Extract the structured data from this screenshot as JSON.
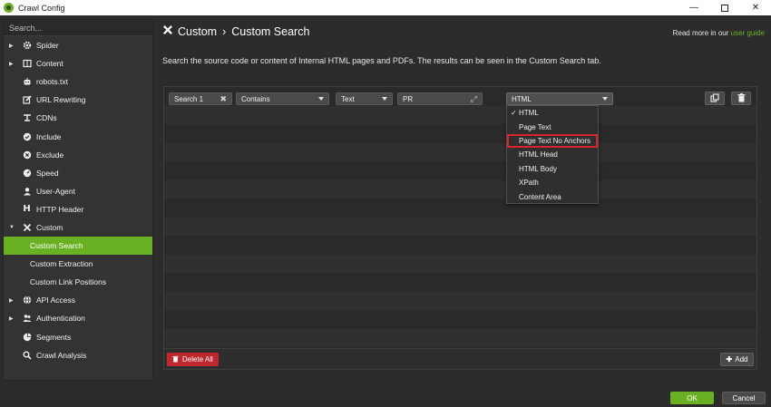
{
  "window": {
    "title": "Crawl Config",
    "minimize": "—",
    "close": "✕"
  },
  "sidebar": {
    "search_placeholder": "Search...",
    "items": [
      {
        "label": "Spider",
        "icon": "gear-icon",
        "expandable": true
      },
      {
        "label": "Content",
        "icon": "content-icon",
        "expandable": true
      },
      {
        "label": "robots.txt",
        "icon": "robot-icon"
      },
      {
        "label": "URL Rewriting",
        "icon": "edit-icon"
      },
      {
        "label": "CDNs",
        "icon": "cdn-icon"
      },
      {
        "label": "Include",
        "icon": "check-circle-icon"
      },
      {
        "label": "Exclude",
        "icon": "x-circle-icon"
      },
      {
        "label": "Speed",
        "icon": "speedometer-icon"
      },
      {
        "label": "User-Agent",
        "icon": "user-secret-icon"
      },
      {
        "label": "HTTP Header",
        "icon": "header-icon"
      },
      {
        "label": "Custom",
        "icon": "tools-icon",
        "expanded": true
      },
      {
        "label": "Custom Search",
        "active": true
      },
      {
        "label": "Custom Extraction"
      },
      {
        "label": "Custom Link Positions"
      },
      {
        "label": "API Access",
        "icon": "globe-icon",
        "expandable": true
      },
      {
        "label": "Authentication",
        "icon": "users-icon",
        "expandable": true
      },
      {
        "label": "Segments",
        "icon": "pie-chart-icon"
      },
      {
        "label": "Crawl Analysis",
        "icon": "search-icon"
      }
    ]
  },
  "header": {
    "section": "Custom",
    "separator": "›",
    "page": "Custom Search",
    "read_more_text": "Read more in our",
    "read_more_link": "user guide"
  },
  "description": "Search the source code or content of Internal HTML pages and PDFs. The results can be seen in the Custom Search tab.",
  "search_row": {
    "name": "Search 1",
    "operator": "Contains",
    "mode": "Text",
    "value": "PR",
    "scope": "HTML"
  },
  "scope_dropdown": {
    "options": [
      "HTML",
      "Page Text",
      "Page Text No Anchors",
      "HTML Head",
      "HTML Body",
      "XPath",
      "Content Area"
    ],
    "selected": "HTML",
    "highlighted": "Page Text No Anchors"
  },
  "footer": {
    "delete_all": "Delete All",
    "add": "Add"
  },
  "dialog": {
    "ok": "OK",
    "cancel": "Cancel"
  },
  "colors": {
    "accent": "#6ab023",
    "danger": "#c0282e",
    "highlight_box": "#d9232e"
  }
}
